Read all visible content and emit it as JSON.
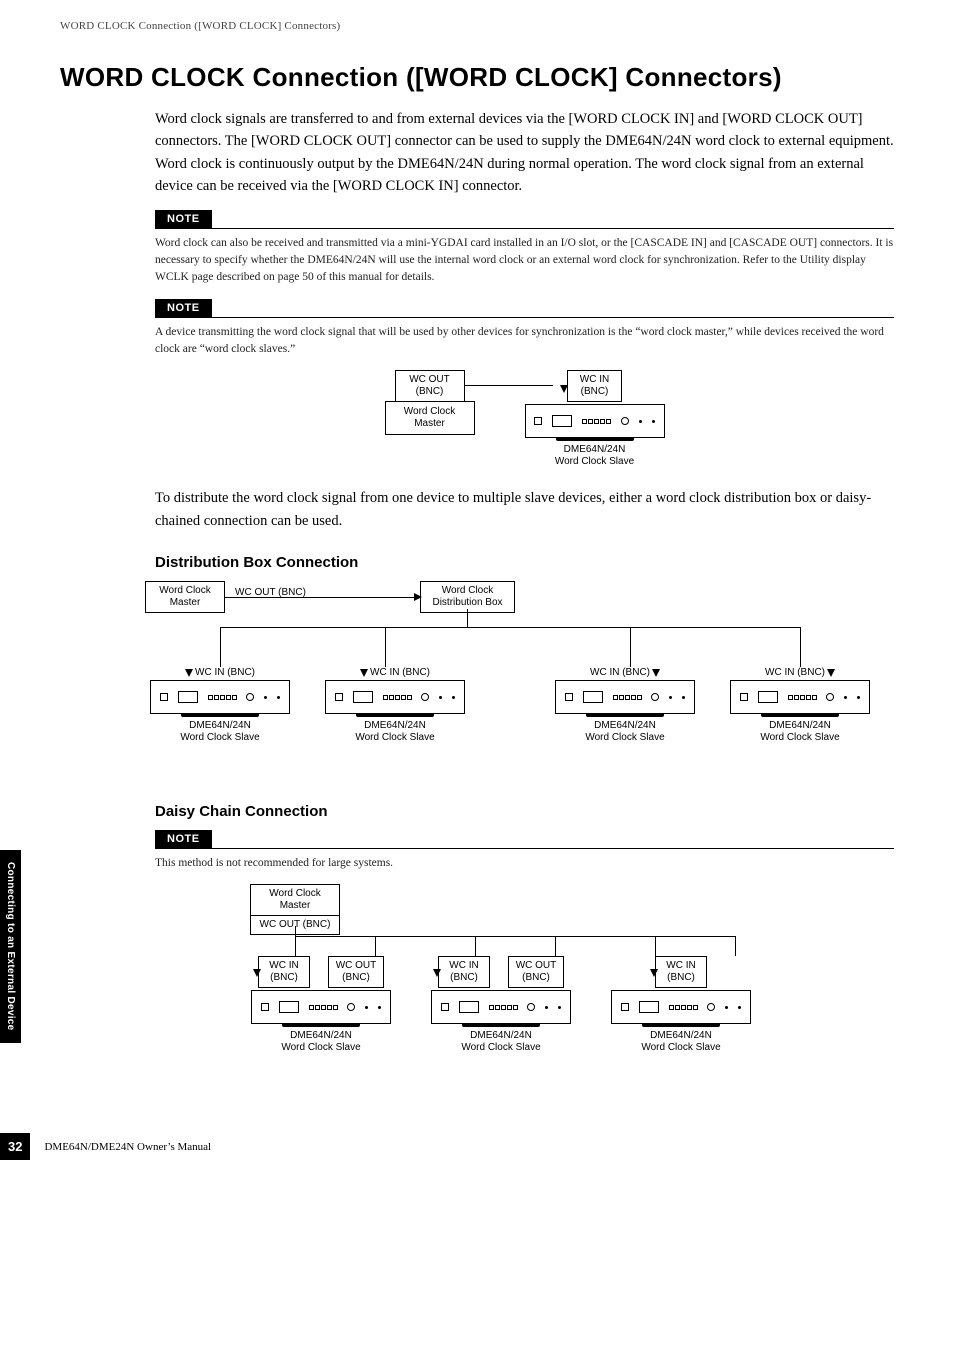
{
  "header": "WORD CLOCK Connection ([WORD CLOCK] Connectors)",
  "title": "WORD CLOCK Connection ([WORD CLOCK] Connectors)",
  "intro": "Word clock signals are transferred to and from external devices via the [WORD CLOCK IN] and [WORD CLOCK OUT] connectors. The [WORD CLOCK OUT] connector can be used to supply the DME64N/24N word clock to external equipment. Word clock is continuously output by the DME64N/24N during normal operation. The word clock signal from an external device can be received via the [WORD CLOCK IN] connector.",
  "note_label": "NOTE",
  "note1": "Word clock can also be received and transmitted via a mini-YGDAI card installed in an I/O slot, or the [CASCADE IN] and [CASCADE OUT] connectors. It is necessary to specify whether the DME64N/24N will use the internal word clock or an external word clock for synchronization. Refer to the Utility display WCLK page described on page 50 of this manual for details.",
  "note2": "A device transmitting the word clock signal that will be used by other devices for synchronization is the “word clock master,” while devices received the word clock are “word clock slaves.”",
  "d1": {
    "wc_out": "WC OUT",
    "wc_in": "WC IN",
    "bnc": "(BNC)",
    "master": "Word Clock\nMaster",
    "device": "DME64N/24N",
    "slave": "Word Clock Slave"
  },
  "midpara": "To distribute the word clock signal from one device to multiple slave devices, either a word clock distribution box or daisy-chained connection can be used.",
  "sub1": "Distribution Box Connection",
  "d2": {
    "master": "Word Clock\nMaster",
    "wc_out": "WC OUT (BNC)",
    "distbox": "Word Clock\nDistribution Box",
    "wc_in": "WC IN (BNC)",
    "device": "DME64N/24N",
    "slave": "Word Clock Slave"
  },
  "sub2": "Daisy Chain Connection",
  "note3": "This method is not recommended for large systems.",
  "d3": {
    "master": "Word Clock\nMaster",
    "wc_out_bnc": "WC OUT (BNC)",
    "wc_in": "WC IN",
    "wc_out": "WC OUT",
    "bnc": "(BNC)",
    "device": "DME64N/24N",
    "slave": "Word Clock Slave"
  },
  "sidebar": "Connecting to an External Device",
  "page": "32",
  "footer": "DME64N/DME24N Owner’s Manual"
}
